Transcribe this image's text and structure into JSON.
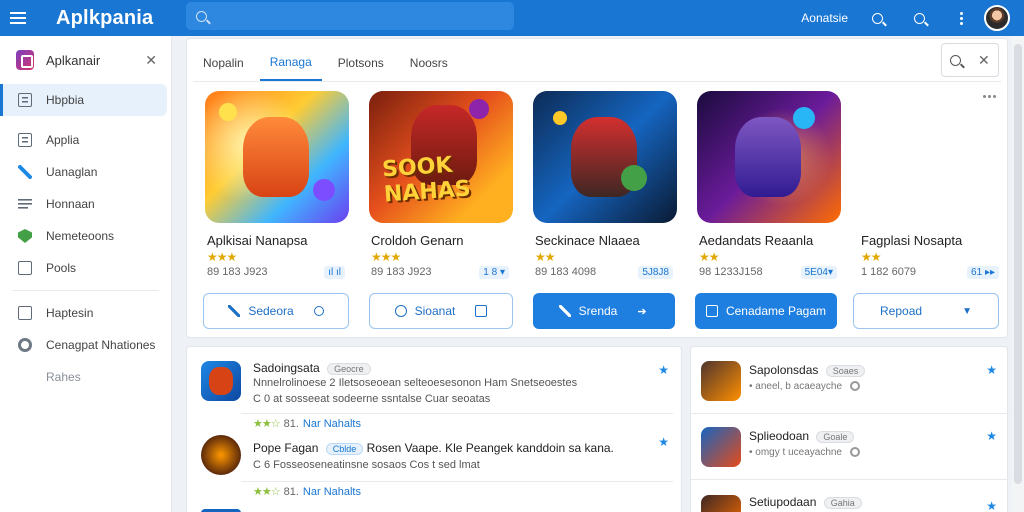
{
  "topbar": {
    "brand": "Aplkpania",
    "search_placeholder": "",
    "link": "Aonatsie",
    "icons": [
      "menu-icon",
      "search-icon",
      "search-icon",
      "more-vert-icon",
      "avatar"
    ]
  },
  "sidebar": {
    "title": "Aplkanair",
    "items": [
      {
        "label": "Hbpbia",
        "icon": "grid-icon",
        "active": true
      },
      {
        "label": "Applia",
        "icon": "grid-icon"
      },
      {
        "label": "Uanaglan",
        "icon": "pencil-icon"
      },
      {
        "label": "Honnaan",
        "icon": "list-icon"
      },
      {
        "label": "Nemeteoons",
        "icon": "shield-icon"
      },
      {
        "label": "Pools",
        "icon": "doc-icon"
      },
      {
        "label": "Haptesin",
        "icon": "doc-icon"
      },
      {
        "label": "Cenagpat Nhationes",
        "icon": "gear-icon"
      },
      {
        "label": "Rahes"
      }
    ]
  },
  "main": {
    "tabs": [
      {
        "label": "Nopalin"
      },
      {
        "label": "Ranaga",
        "active": true
      },
      {
        "label": "Plotsons"
      },
      {
        "label": "Noosrs"
      }
    ],
    "games": [
      {
        "title": "Aplkisai Nanapsa",
        "stars": "★★★",
        "meta": "89 183 J923",
        "badge": "ıl ıl"
      },
      {
        "title": "Croldoh Genarn",
        "stars": "★★★",
        "meta": "89 183 J923",
        "badge": "1 8 ▾"
      },
      {
        "title": "Seckinace Nlaaea",
        "stars": "★★",
        "meta": "89 183 4098",
        "badge": "5J8J8"
      },
      {
        "title": "Aedandats Reaanla",
        "stars": "★★",
        "meta": "98 1233J158",
        "badge": "5E04▾"
      },
      {
        "title": "Fagplasi Nosapta",
        "stars": "★★",
        "meta": "1 182 6079",
        "badge": "61 ▸▸"
      }
    ],
    "thumb_text": "SOOK NAHAS",
    "actions": [
      {
        "label": "Sedeora",
        "style": "outline"
      },
      {
        "label": "Sioanat",
        "style": "outline"
      },
      {
        "label": "Srenda",
        "style": "fill"
      },
      {
        "label": "Cenadame Pagam",
        "style": "fill"
      },
      {
        "label": "Repoad",
        "style": "outline"
      }
    ]
  },
  "list": [
    {
      "title": "Sadoingsata",
      "pill": "Geocre",
      "desc1": "Nnnelrolinoese 2 Iletsoseoean selteoesesonon Ham Snetseoestes",
      "desc2": "C 0 at sosseeat sodeerne ssntalse  Cuar seoatas",
      "rating": "81.",
      "link1": "Nar",
      "link2": "Nahalts"
    },
    {
      "title": "Pope Fagan",
      "pill": "Cblde",
      "title_rest": "Rosen Vaape. Kle Peangek kanddoin sa kana.",
      "desc2": "C 6 Fosseoseneatinsne sosaos  Cos t sed lmat",
      "rating": "81.",
      "link1": "Nar",
      "link2": "Nahalts"
    }
  ],
  "side_list": [
    {
      "title": "Sapolonsdas",
      "pill": "Soaes",
      "sub": "• aneel, b acaeayche"
    },
    {
      "title": "Splieodoan",
      "pill": "Goale",
      "sub": "• omgy t uceayachne"
    },
    {
      "title": "Setiupodaan",
      "pill": "Gahia"
    }
  ],
  "colors": {
    "topbar": "#1976d2",
    "accent": "#1e7fe0",
    "star": "#e1a800"
  }
}
